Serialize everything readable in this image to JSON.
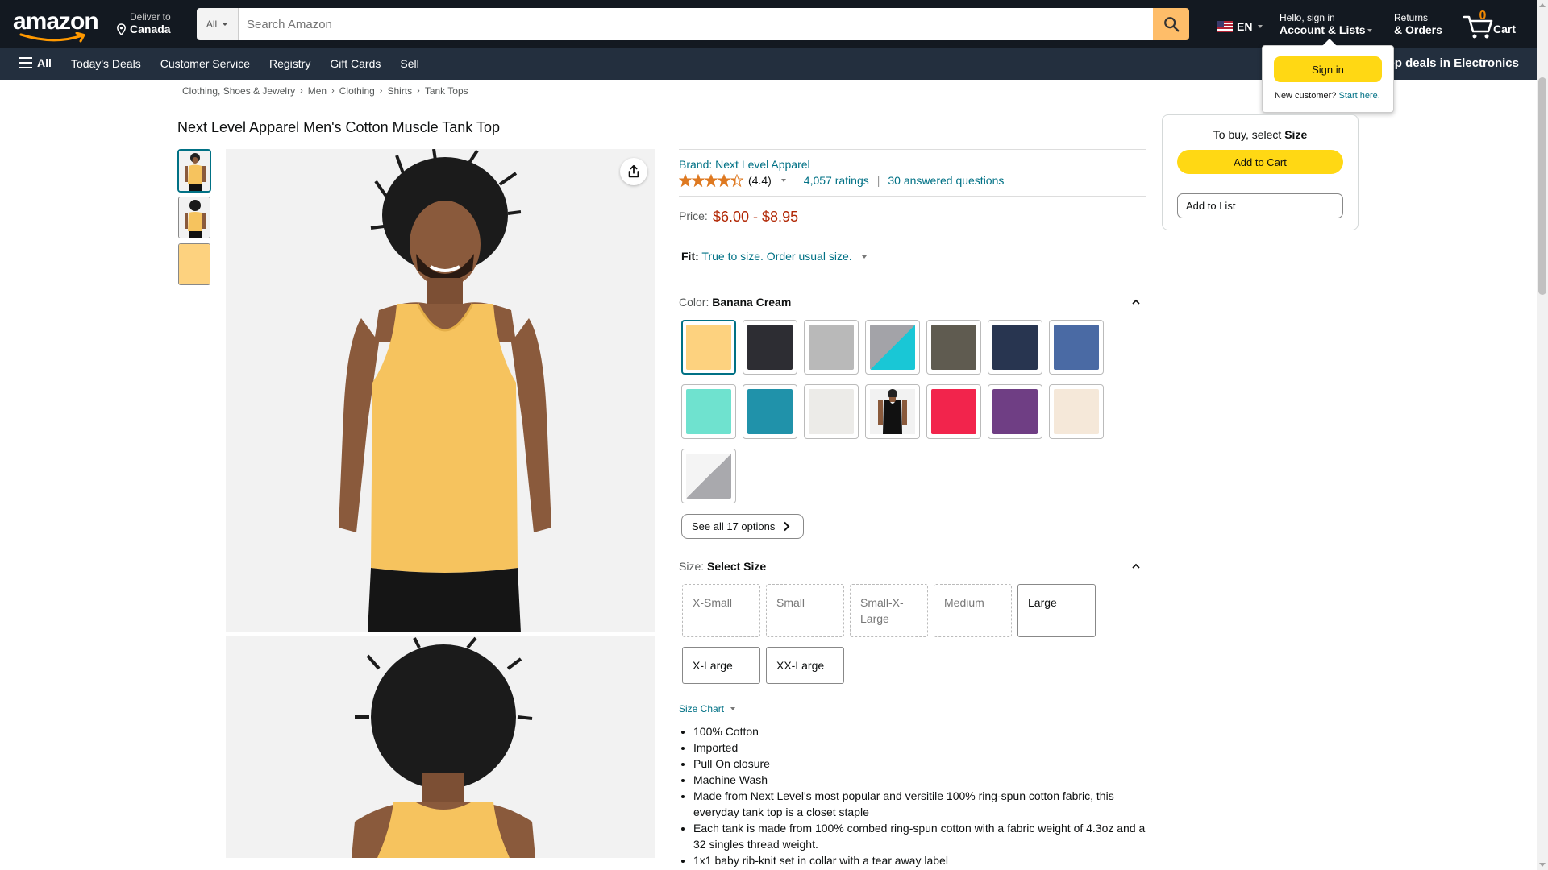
{
  "header": {
    "logo_text": "amazon",
    "deliver_line1": "Deliver to",
    "deliver_line2": "Canada",
    "search_category": "All",
    "search_placeholder": "Search Amazon",
    "language": "EN",
    "account_line1": "Hello, sign in",
    "account_line2": "Account & Lists",
    "returns_line1": "Returns",
    "returns_line2": "& Orders",
    "cart_count": "0",
    "cart_label": "Cart"
  },
  "subnav": {
    "all_label": "All",
    "links": [
      "Today's Deals",
      "Customer Service",
      "Registry",
      "Gift Cards",
      "Sell"
    ],
    "promo": "op deals in Electronics"
  },
  "signin_flyout": {
    "button": "Sign in",
    "new_customer": "New customer?",
    "start_here": "Start here."
  },
  "breadcrumb": [
    "Clothing, Shoes & Jewelry",
    "Men",
    "Clothing",
    "Shirts",
    "Tank Tops"
  ],
  "product": {
    "title": "Next Level Apparel Men's Cotton Muscle Tank Top",
    "brand": "Brand: Next Level Apparel",
    "rating_value": "(4.4)",
    "stars": 4.4,
    "ratings_count": "4,057 ratings",
    "answered": "30 answered questions",
    "price_label": "Price:",
    "price": "$6.00 - $8.95",
    "fit_label": "Fit:",
    "fit_value": "True to size. Order usual size.",
    "color_label": "Color:",
    "color_value": "Banana Cream",
    "see_all": "See all 17 options",
    "size_label": "Size:",
    "size_value": "Select Size",
    "size_chart": "Size Chart",
    "bullets": [
      "100% Cotton",
      "Imported",
      "Pull On closure",
      "Machine Wash",
      "Made from Next Level's most popular and versitile 100% ring-spun cotton fabric, this everyday tank top is a closet staple",
      "Each tank is made from 100% combed ring-spun cotton with a fabric weight of 4.3oz and a 32 singles thread weight.",
      "1x1 baby rib-knit set in collar with a tear away label"
    ]
  },
  "swatch_colors": [
    "#fdd27f",
    "#2d2d33",
    "#b9b9b9",
    "split-heather-turquoise",
    "#5f5b50",
    "#283550",
    "#4a6aa4",
    "#6fe2cf",
    "#2092aa",
    "#ecebe8",
    "model-black",
    "#f2244c",
    "#6f3e84",
    "#f5e8d9",
    "split-white-heather"
  ],
  "sizes": [
    {
      "label": "X-Small",
      "available": false
    },
    {
      "label": "Small",
      "available": false
    },
    {
      "label": "Small-X-Large",
      "available": false
    },
    {
      "label": "Medium",
      "available": false
    },
    {
      "label": "Large",
      "available": true
    },
    {
      "label": "X-Large",
      "available": true
    },
    {
      "label": "XX-Large",
      "available": true
    }
  ],
  "buybox": {
    "head_prefix": "To buy, select ",
    "head_bold": "Size",
    "add_to_cart": "Add to Cart",
    "add_to_list": "Add to List"
  },
  "colors": {
    "nav_dark": "#131921",
    "nav_sub": "#232f3e",
    "search_button": "#febd69",
    "cta_yellow": "#ffd814",
    "link": "#007185",
    "price": "#b12704",
    "tank": "#f6c35e"
  }
}
